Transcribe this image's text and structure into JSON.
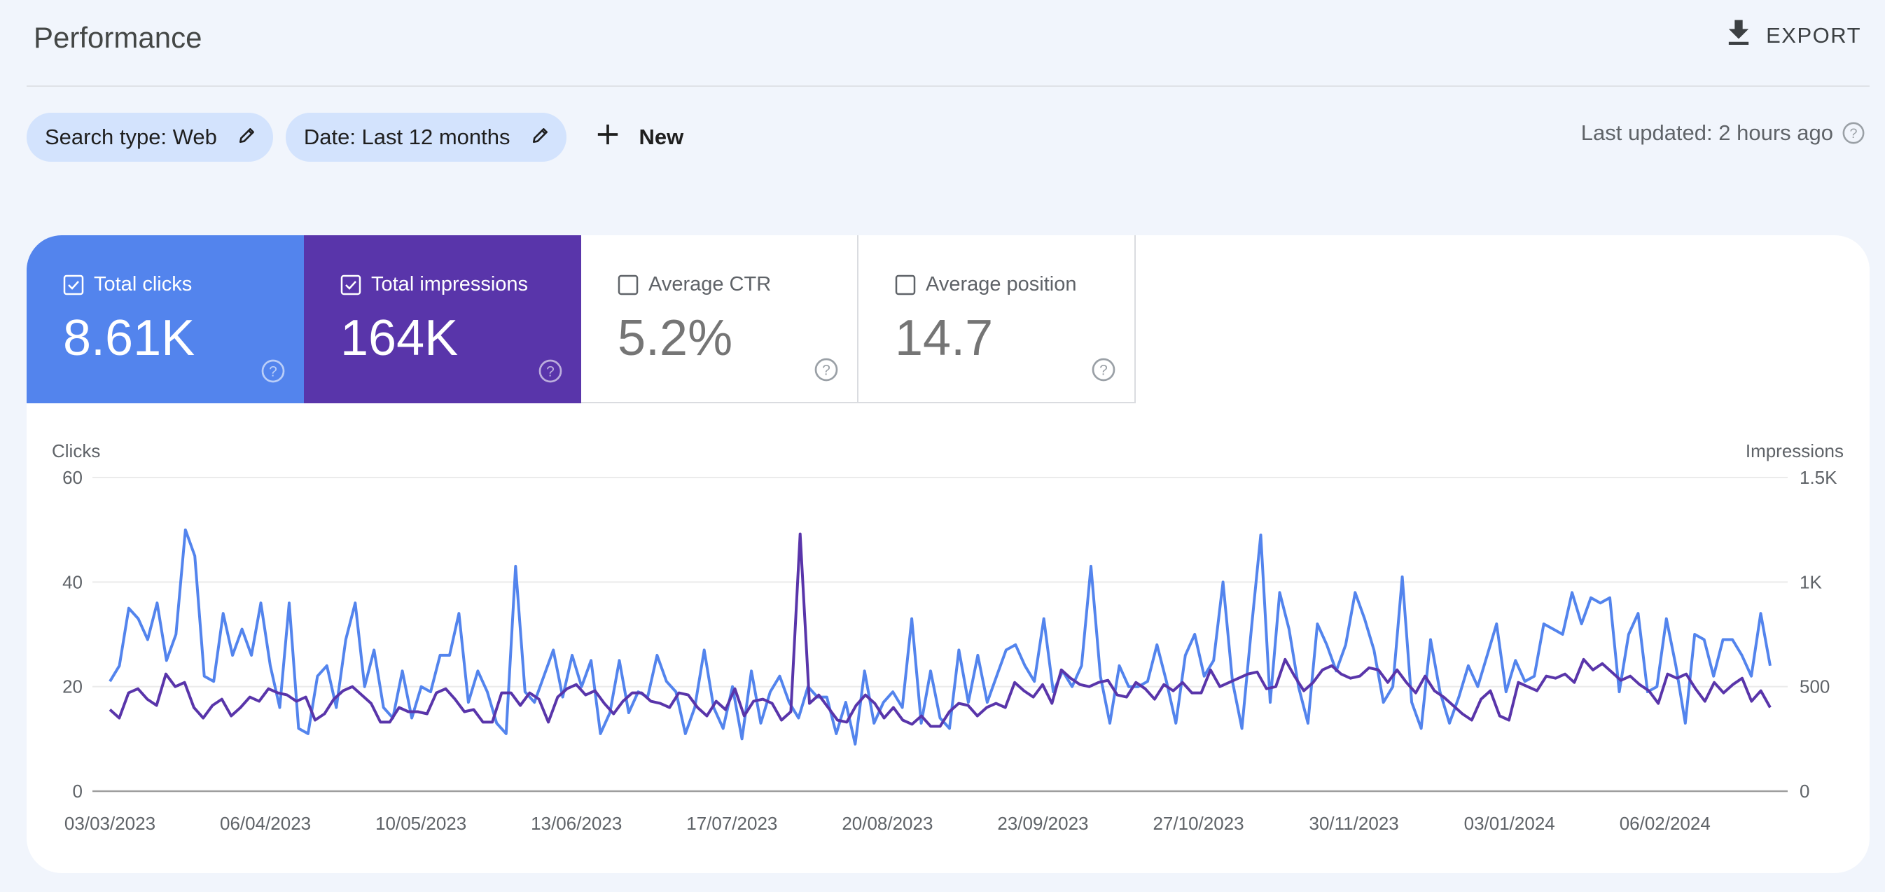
{
  "header": {
    "title": "Performance",
    "export_label": "EXPORT",
    "export_icon": "download-icon"
  },
  "filters": {
    "chips": [
      {
        "label": "Search type: Web",
        "icon": "edit-pencil-icon"
      },
      {
        "label": "Date: Last 12 months",
        "icon": "edit-pencil-icon"
      }
    ],
    "new_label": "New",
    "new_icon": "plus-icon",
    "last_updated": "Last updated: 2 hours ago",
    "last_updated_icon": "help-icon"
  },
  "metrics": [
    {
      "label": "Total clicks",
      "value": "8.61K",
      "checked": true,
      "color": "#5384ed"
    },
    {
      "label": "Total impressions",
      "value": "164K",
      "checked": true,
      "color": "#5935aa"
    },
    {
      "label": "Average CTR",
      "value": "5.2%",
      "checked": false
    },
    {
      "label": "Average position",
      "value": "14.7",
      "checked": false
    }
  ],
  "chart_data": {
    "type": "line",
    "title": "",
    "y_left_label": "Clicks",
    "y_right_label": "Impressions",
    "y_left_ticks": [
      "0",
      "20",
      "40",
      "60"
    ],
    "y_left_range": [
      0,
      60
    ],
    "y_right_ticks": [
      "0",
      "500",
      "1K",
      "1.5K"
    ],
    "y_right_range": [
      0,
      1500
    ],
    "x_tick_labels": [
      "03/03/2023",
      "06/04/2023",
      "10/05/2023",
      "13/06/2023",
      "17/07/2023",
      "20/08/2023",
      "23/09/2023",
      "27/10/2023",
      "30/11/2023",
      "03/01/2024",
      "06/02/2024"
    ],
    "x_start": "03/03/2023",
    "x_end": "28/02/2024",
    "x_step_days": 3,
    "grid": true,
    "series": [
      {
        "name": "Clicks",
        "axis": "left",
        "color": "#5384ed",
        "values": [
          21,
          24,
          35,
          33,
          29,
          36,
          25,
          30,
          50,
          45,
          22,
          21,
          34,
          26,
          31,
          26,
          36,
          24,
          16,
          36,
          12,
          11,
          22,
          24,
          16,
          29,
          36,
          20,
          27,
          16,
          14,
          23,
          14,
          20,
          19,
          26,
          26,
          34,
          17,
          23,
          19,
          13,
          11,
          43,
          19,
          17,
          22,
          27,
          18,
          26,
          20,
          25,
          11,
          15,
          25,
          15,
          19,
          18,
          26,
          21,
          19,
          11,
          16,
          27,
          16,
          12,
          20,
          10,
          23,
          13,
          19,
          22,
          17,
          14,
          20,
          18,
          18,
          11,
          17,
          9,
          23,
          13,
          17,
          19,
          16,
          33,
          13,
          23,
          14,
          12,
          27,
          17,
          26,
          17,
          22,
          27,
          28,
          24,
          21,
          33,
          19,
          23,
          20,
          24,
          43,
          22,
          13,
          24,
          20,
          20,
          21,
          28,
          21,
          13,
          26,
          30,
          22,
          25,
          40,
          21,
          12,
          31,
          49,
          17,
          38,
          31,
          20,
          13,
          32,
          28,
          23,
          28,
          38,
          33,
          27,
          17,
          20,
          41,
          17,
          12,
          29,
          19,
          13,
          18,
          24,
          20,
          26,
          32,
          19,
          25,
          21,
          22,
          32,
          31,
          30,
          38,
          32,
          37,
          36,
          37,
          19,
          30,
          34,
          19,
          20,
          33,
          24,
          13,
          30,
          29,
          22,
          29,
          29,
          26,
          22,
          34,
          24
        ]
      },
      {
        "name": "Impressions",
        "axis": "right",
        "color": "#5935aa",
        "values": [
          390,
          350,
          470,
          490,
          440,
          410,
          560,
          500,
          520,
          400,
          350,
          410,
          440,
          360,
          400,
          450,
          430,
          490,
          470,
          460,
          430,
          450,
          340,
          370,
          440,
          480,
          500,
          460,
          420,
          330,
          330,
          400,
          380,
          380,
          370,
          470,
          490,
          440,
          380,
          390,
          330,
          330,
          470,
          470,
          410,
          470,
          440,
          330,
          450,
          490,
          510,
          460,
          480,
          420,
          370,
          430,
          470,
          470,
          430,
          420,
          400,
          470,
          460,
          400,
          360,
          430,
          390,
          490,
          360,
          430,
          440,
          420,
          340,
          380,
          1230,
          420,
          460,
          400,
          340,
          330,
          410,
          460,
          420,
          350,
          400,
          340,
          320,
          360,
          310,
          310,
          380,
          420,
          410,
          360,
          400,
          420,
          400,
          520,
          480,
          450,
          510,
          420,
          580,
          540,
          510,
          500,
          520,
          530,
          460,
          450,
          520,
          490,
          440,
          510,
          480,
          520,
          470,
          470,
          580,
          500,
          520,
          540,
          560,
          570,
          490,
          500,
          630,
          550,
          480,
          520,
          580,
          600,
          560,
          540,
          550,
          590,
          580,
          520,
          580,
          520,
          470,
          550,
          480,
          450,
          410,
          370,
          340,
          440,
          480,
          360,
          340,
          520,
          500,
          480,
          550,
          540,
          560,
          520,
          630,
          580,
          610,
          570,
          530,
          550,
          510,
          480,
          420,
          560,
          540,
          560,
          490,
          430,
          520,
          470,
          510,
          540,
          430,
          480,
          400
        ]
      }
    ]
  }
}
